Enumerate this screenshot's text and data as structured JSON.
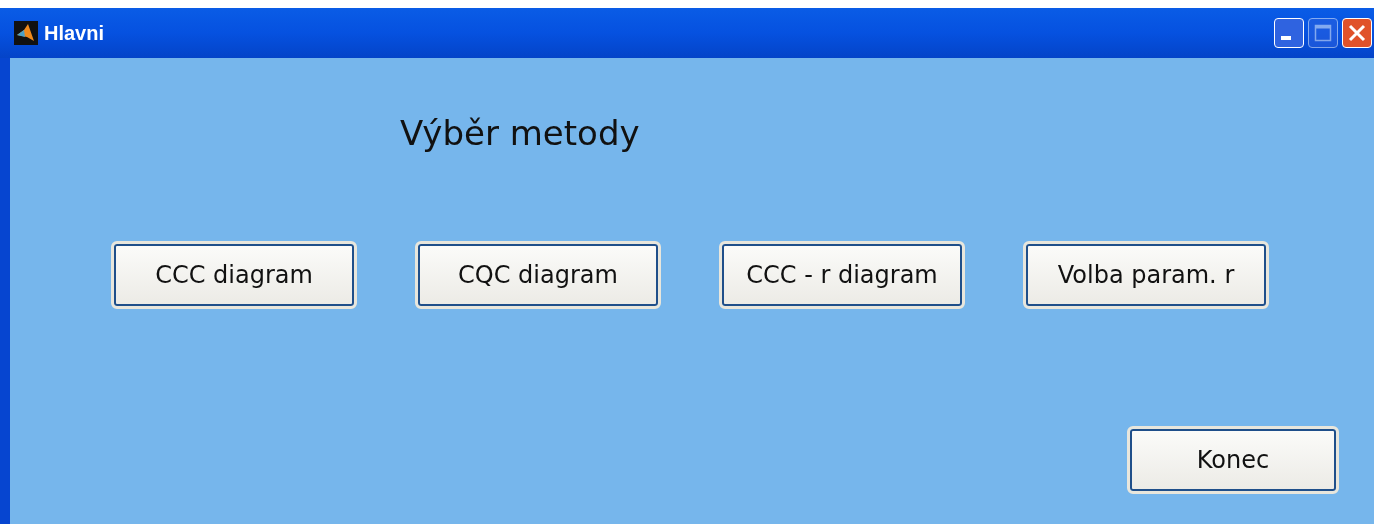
{
  "window": {
    "title": "Hlavni",
    "controls": [
      {
        "kind": "minimize",
        "disabled": false
      },
      {
        "kind": "maximize",
        "disabled": true
      },
      {
        "kind": "close",
        "disabled": false
      }
    ]
  },
  "heading": "Výběr metody",
  "buttons": [
    "CCC diagram",
    "CQC diagram",
    "CCC - r diagram",
    "Volba param. r"
  ],
  "exit_button": "Konec"
}
